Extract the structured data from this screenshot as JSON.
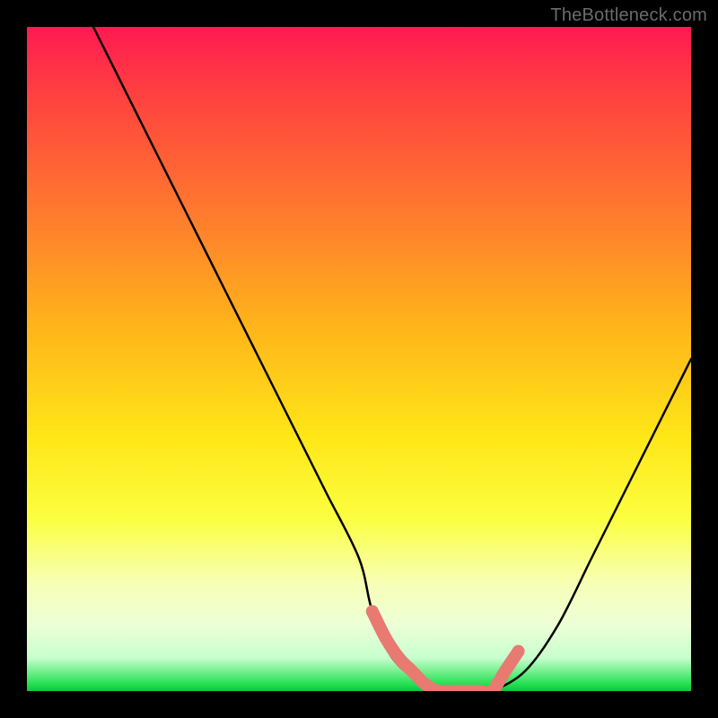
{
  "watermark": "TheBottleneck.com",
  "chart_data": {
    "type": "line",
    "title": "",
    "xlabel": "",
    "ylabel": "",
    "xlim": [
      0,
      100
    ],
    "ylim": [
      0,
      100
    ],
    "grid": false,
    "series": [
      {
        "name": "bottleneck-curve",
        "color": "#000000",
        "x": [
          10,
          15,
          20,
          25,
          30,
          35,
          40,
          45,
          50,
          52,
          55,
          60,
          65,
          68,
          70,
          75,
          80,
          85,
          90,
          95,
          100
        ],
        "y": [
          100,
          90,
          80,
          70,
          60,
          50,
          40,
          30,
          20,
          12,
          5,
          1,
          0,
          0,
          0,
          3,
          10,
          20,
          30,
          40,
          50
        ]
      },
      {
        "name": "optimal-band",
        "color": "#e87a72",
        "x": [
          52,
          54,
          56,
          58,
          60,
          62,
          64,
          66,
          68,
          70,
          72,
          74
        ],
        "y": [
          12,
          8,
          5,
          3,
          1,
          0,
          0,
          0,
          0,
          0,
          3,
          6
        ]
      }
    ],
    "annotations": []
  }
}
